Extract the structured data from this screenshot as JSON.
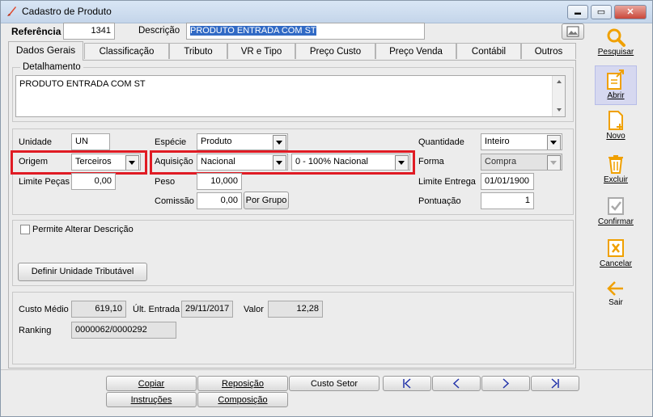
{
  "window": {
    "title": "Cadastro de Produto",
    "min": "▬",
    "max": "▭",
    "close": "✕"
  },
  "header": {
    "referencia_label": "Referência",
    "referencia_value": "1341",
    "descricao_label": "Descrição",
    "descricao_value": "PRODUTO ENTRADA COM ST"
  },
  "tabs": [
    "Dados Gerais",
    "Classificação",
    "Tributo",
    "VR e Tipo",
    "Preço Custo",
    "Preço Venda",
    "Contábil",
    "Outros"
  ],
  "detalhamento": {
    "legend": "Detalhamento",
    "text": "PRODUTO ENTRADA COM ST"
  },
  "form": {
    "unidade_label": "Unidade",
    "unidade_value": "UN",
    "origem_label": "Origem",
    "origem_value": "Terceiros",
    "limite_pecas_label": "Limite Peças",
    "limite_pecas_value": "0,00",
    "especie_label": "Espécie",
    "especie_value": "Produto",
    "aquisicao_label": "Aquisição",
    "aquisicao_value": "Nacional",
    "aquisicao_detail": "0 - 100% Nacional",
    "peso_label": "Peso",
    "peso_value": "10,000",
    "comissao_label": "Comissão",
    "comissao_value": "0,00",
    "por_grupo": "Por Grupo",
    "quantidade_label": "Quantidade",
    "quantidade_value": "Inteiro",
    "forma_label": "Forma",
    "forma_value": "Compra",
    "limite_entrega_label": "Limite Entrega",
    "limite_entrega_value": "01/01/1900",
    "pontuacao_label": "Pontuação",
    "pontuacao_value": "1"
  },
  "options": {
    "permite_alterar": "Permite Alterar Descrição",
    "definir_unidade": "Definir Unidade Tributável"
  },
  "costs": {
    "custo_medio_label": "Custo Médio",
    "custo_medio_value": "619,10",
    "ult_entrada_label": "Últ. Entrada",
    "ult_entrada_value": "29/11/2017",
    "valor_label": "Valor",
    "valor_value": "12,28",
    "ranking_label": "Ranking",
    "ranking_value": "0000062/0000292"
  },
  "sidebar": {
    "pesquisar": "Pesquisar",
    "abrir": "Abrir",
    "novo": "Novo",
    "excluir": "Excluir",
    "confirmar": "Confirmar",
    "cancelar": "Cancelar",
    "sair": "Sair"
  },
  "bottom": {
    "copiar": "Copiar",
    "reposicao": "Reposição",
    "custo_setor": "Custo Setor",
    "instrucoes": "Instruções",
    "composicao": "Composição"
  },
  "colors": {
    "highlight_red": "#e01b24",
    "selection_blue": "#316ac5",
    "accent_orange": "#f0a000"
  }
}
